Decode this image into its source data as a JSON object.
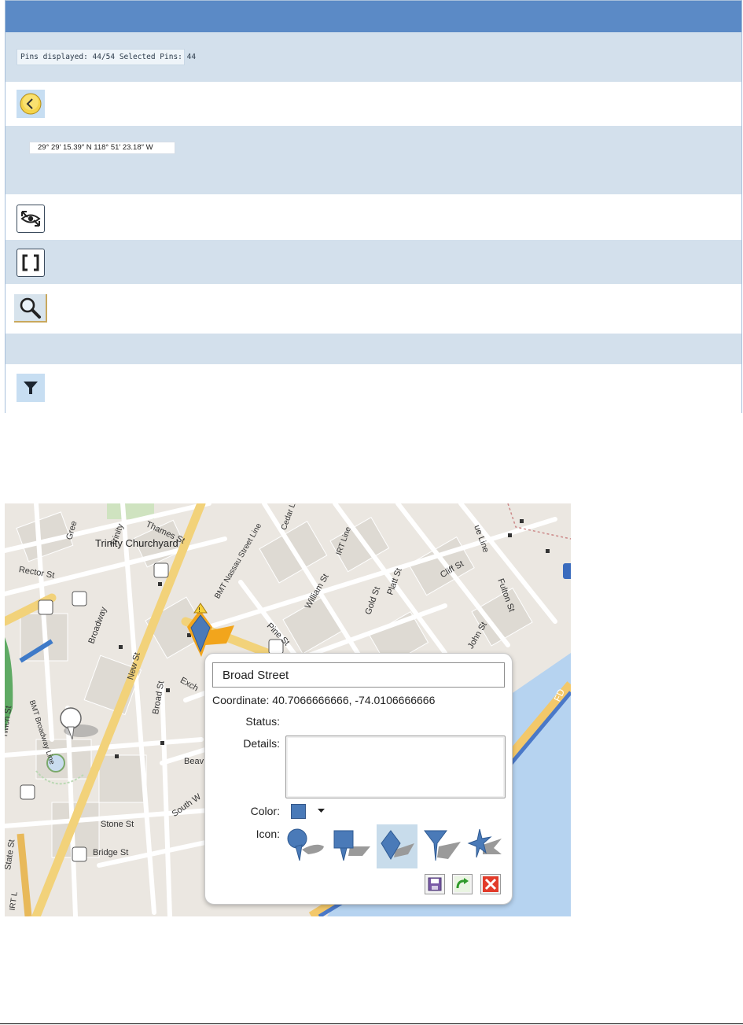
{
  "toolbar": {
    "pins_status": "Pins displayed: 44/54  Selected Pins: 44",
    "coordinate_readout": "29° 29′ 15.39″ N 118° 51′ 23.18″ W"
  },
  "map": {
    "streets": {
      "trinity": "Trinity",
      "thames": "Thames St",
      "trinity_churchyard": "Trinity Churchyard",
      "rector": "Rector St",
      "broadway": "Broadway",
      "bmt_nassau": "BMT Nassau Street Line",
      "cedar": "Cedar Ln",
      "irt_line": "IRT Line",
      "william": "William St",
      "platt": "Platt St",
      "gold": "Gold St",
      "cliff": "Cliff St",
      "fulton": "Fulton St",
      "pine": "Pine St",
      "john": "John St",
      "new": "New St",
      "broad": "Broad St",
      "exchange": "Exch",
      "bmt_broadway": "BMT Broadway Line",
      "greenwich": "rwich St",
      "beaver": "Beav",
      "south_william": "South W",
      "stone": "Stone St",
      "bridge": "Bridge St",
      "state": "State St",
      "irt_l": "IRT L",
      "ue_line": "ue Line",
      "green": "Gree",
      "fd": "FD"
    },
    "popup": {
      "title": "Broad Street",
      "coordinate_label": "Coordinate:",
      "coordinate_value": "40.7066666666, -74.0106666666",
      "status_label": "Status:",
      "status_value": "",
      "details_label": "Details:",
      "details_value": "",
      "color_label": "Color:",
      "color_value": "#4a7ab8",
      "icon_label": "Icon:",
      "icons": [
        "pin-round-icon",
        "pin-square-icon",
        "pin-diamond-icon",
        "pin-triangle-icon",
        "pin-star-icon"
      ],
      "selected_icon": "pin-diamond-icon"
    }
  }
}
